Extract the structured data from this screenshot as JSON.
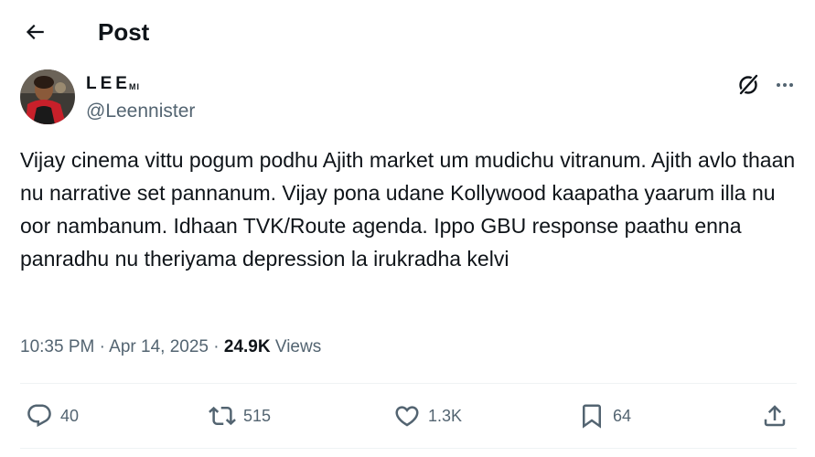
{
  "header": {
    "back_icon": "arrow-left-icon",
    "title": "Post"
  },
  "author": {
    "display_name": "LEE",
    "display_name_suffix": "MI",
    "handle": "@Leennister",
    "avatar_icon": "user-avatar"
  },
  "tweet": {
    "text": "Vijay cinema vittu pogum podhu Ajith market um mudichu vitranum. Ajith avlo thaan nu narrative set pannanum. Vijay pona udane Kollywood kaapatha yaarum illa nu oor nambanum. Idhaan TVK/Route agenda. Ippo GBU response paathu enna panradhu nu theriyama depression la irukradha kelvi"
  },
  "meta": {
    "time": "10:35 PM",
    "separator1": " · ",
    "date": "Apr 14, 2025",
    "separator2": " · ",
    "views_count": "24.9K",
    "views_label": "Views"
  },
  "actions": {
    "replies": "40",
    "reposts": "515",
    "likes": "1.3K",
    "bookmarks": "64"
  },
  "colors": {
    "text_primary": "#0f1419",
    "text_secondary": "#536471",
    "divider": "#eff3f4"
  }
}
